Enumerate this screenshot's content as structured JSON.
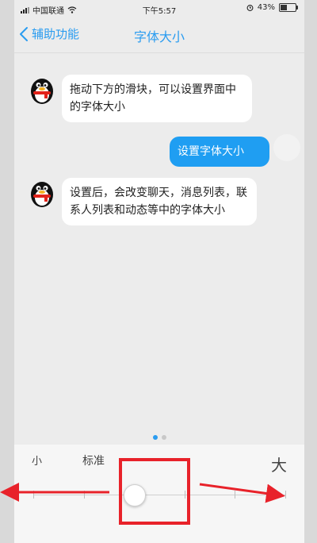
{
  "status_bar": {
    "carrier": "中国联通",
    "time": "下午5:57",
    "battery_percent": "43%",
    "battery_level": 0.43
  },
  "nav": {
    "back_label": "辅助功能",
    "title": "字体大小"
  },
  "chat": {
    "messages": [
      {
        "from": "assistant",
        "text": "拖动下方的滑块，可以设置界面中的字体大小"
      },
      {
        "from": "user",
        "text": "设置字体大小"
      },
      {
        "from": "assistant",
        "text": "设置后，会改变聊天，消息列表，联系人列表和动态等中的字体大小"
      }
    ]
  },
  "pager": {
    "count": 2,
    "active": 0
  },
  "font_size": {
    "label_small": "小",
    "label_standard": "标准",
    "label_large": "大",
    "levels": 6,
    "selected_level": 2
  },
  "colors": {
    "accent": "#2a9cf0",
    "outgoing_bubble": "#1f9ef2",
    "annotation": "#e8222a"
  }
}
